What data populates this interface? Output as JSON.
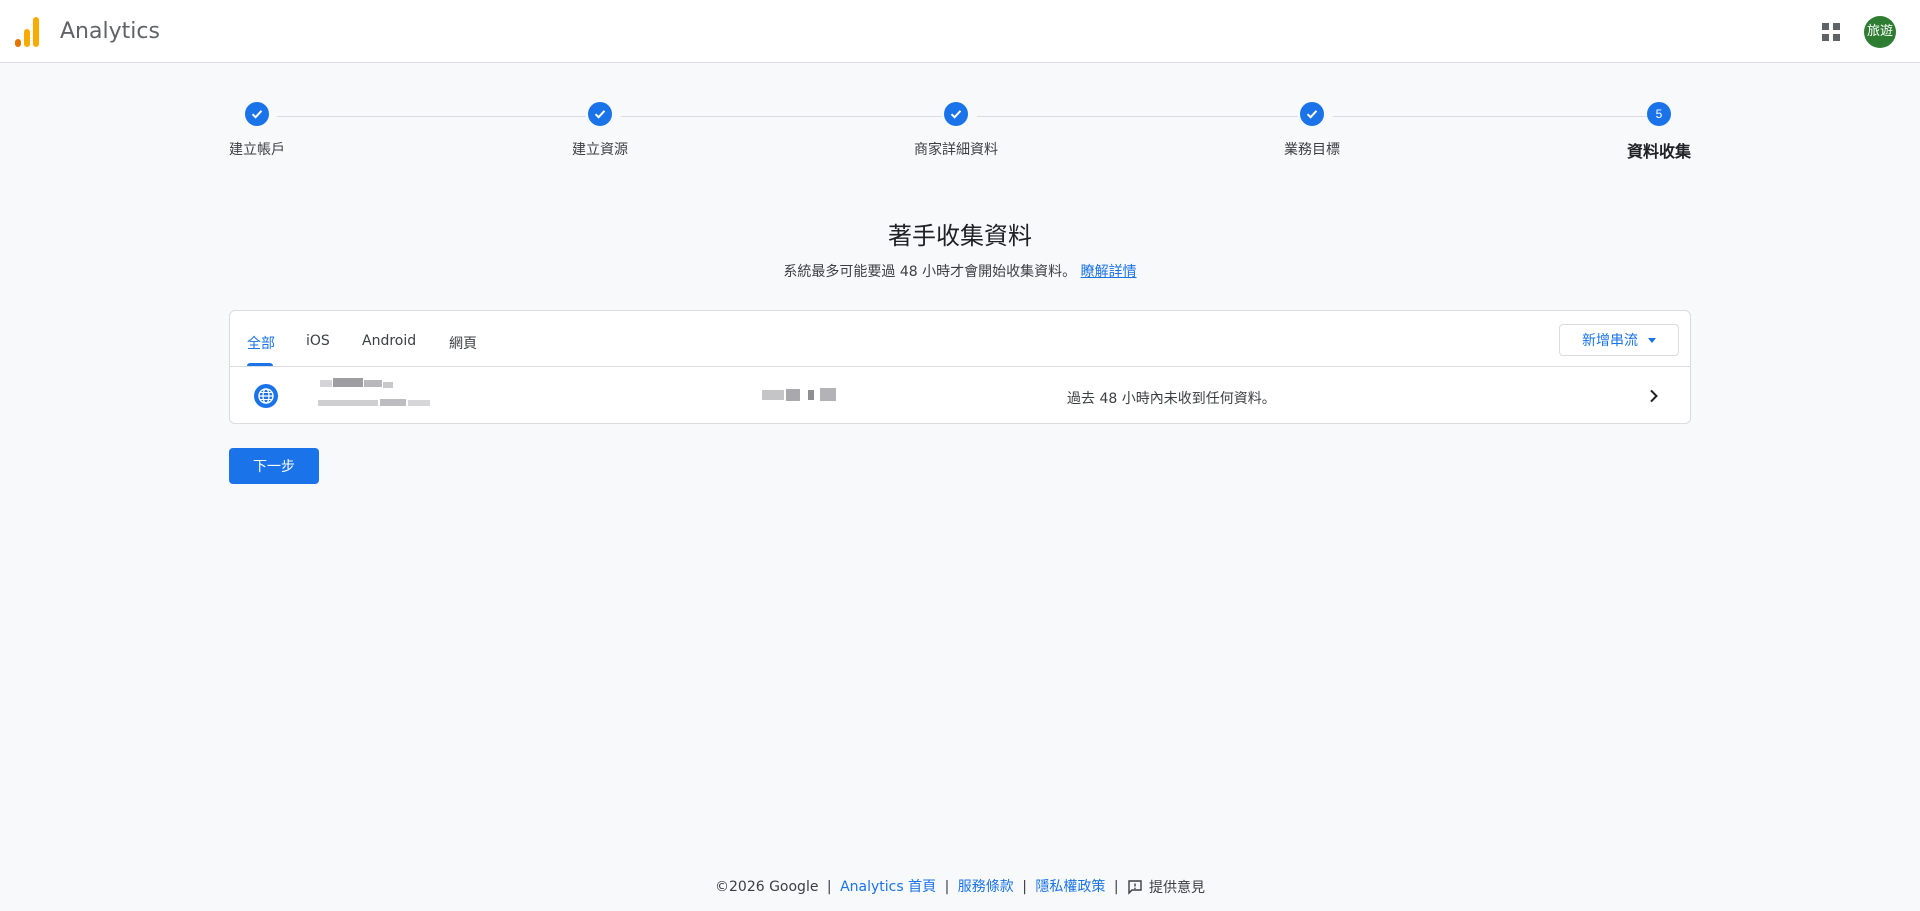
{
  "header": {
    "app_title": "Analytics",
    "avatar_text": "旅遊",
    "logo_colors": [
      "#e37400",
      "#f9ab00"
    ]
  },
  "stepper": {
    "steps": [
      {
        "label": "建立帳戶",
        "state": "done"
      },
      {
        "label": "建立資源",
        "state": "done"
      },
      {
        "label": "商家詳細資料",
        "state": "done"
      },
      {
        "label": "業務目標",
        "state": "done"
      },
      {
        "label": "資料收集",
        "state": "current",
        "number": "5"
      }
    ]
  },
  "main": {
    "title": "著手收集資料",
    "subtitle": "系統最多可能要過 48 小時才會開始收集資料。",
    "learn_more": "瞭解詳情"
  },
  "streams": {
    "tabs": [
      "全部",
      "iOS",
      "Android",
      "網頁"
    ],
    "active_tab": "全部",
    "add_stream_label": "新增串流",
    "rows": [
      {
        "icon": "globe-icon",
        "status": "過去 48 小時內未收到任何資料。"
      }
    ]
  },
  "next_button": "下一步",
  "footer": {
    "copyright": "©2026 Google",
    "links": [
      "Analytics 首頁",
      "服務條款",
      "隱私權政策"
    ],
    "feedback": "提供意見"
  },
  "colors": {
    "accent": "#1a73e8",
    "avatar_bg": "#2e7d32",
    "background": "#f8f9fa"
  }
}
